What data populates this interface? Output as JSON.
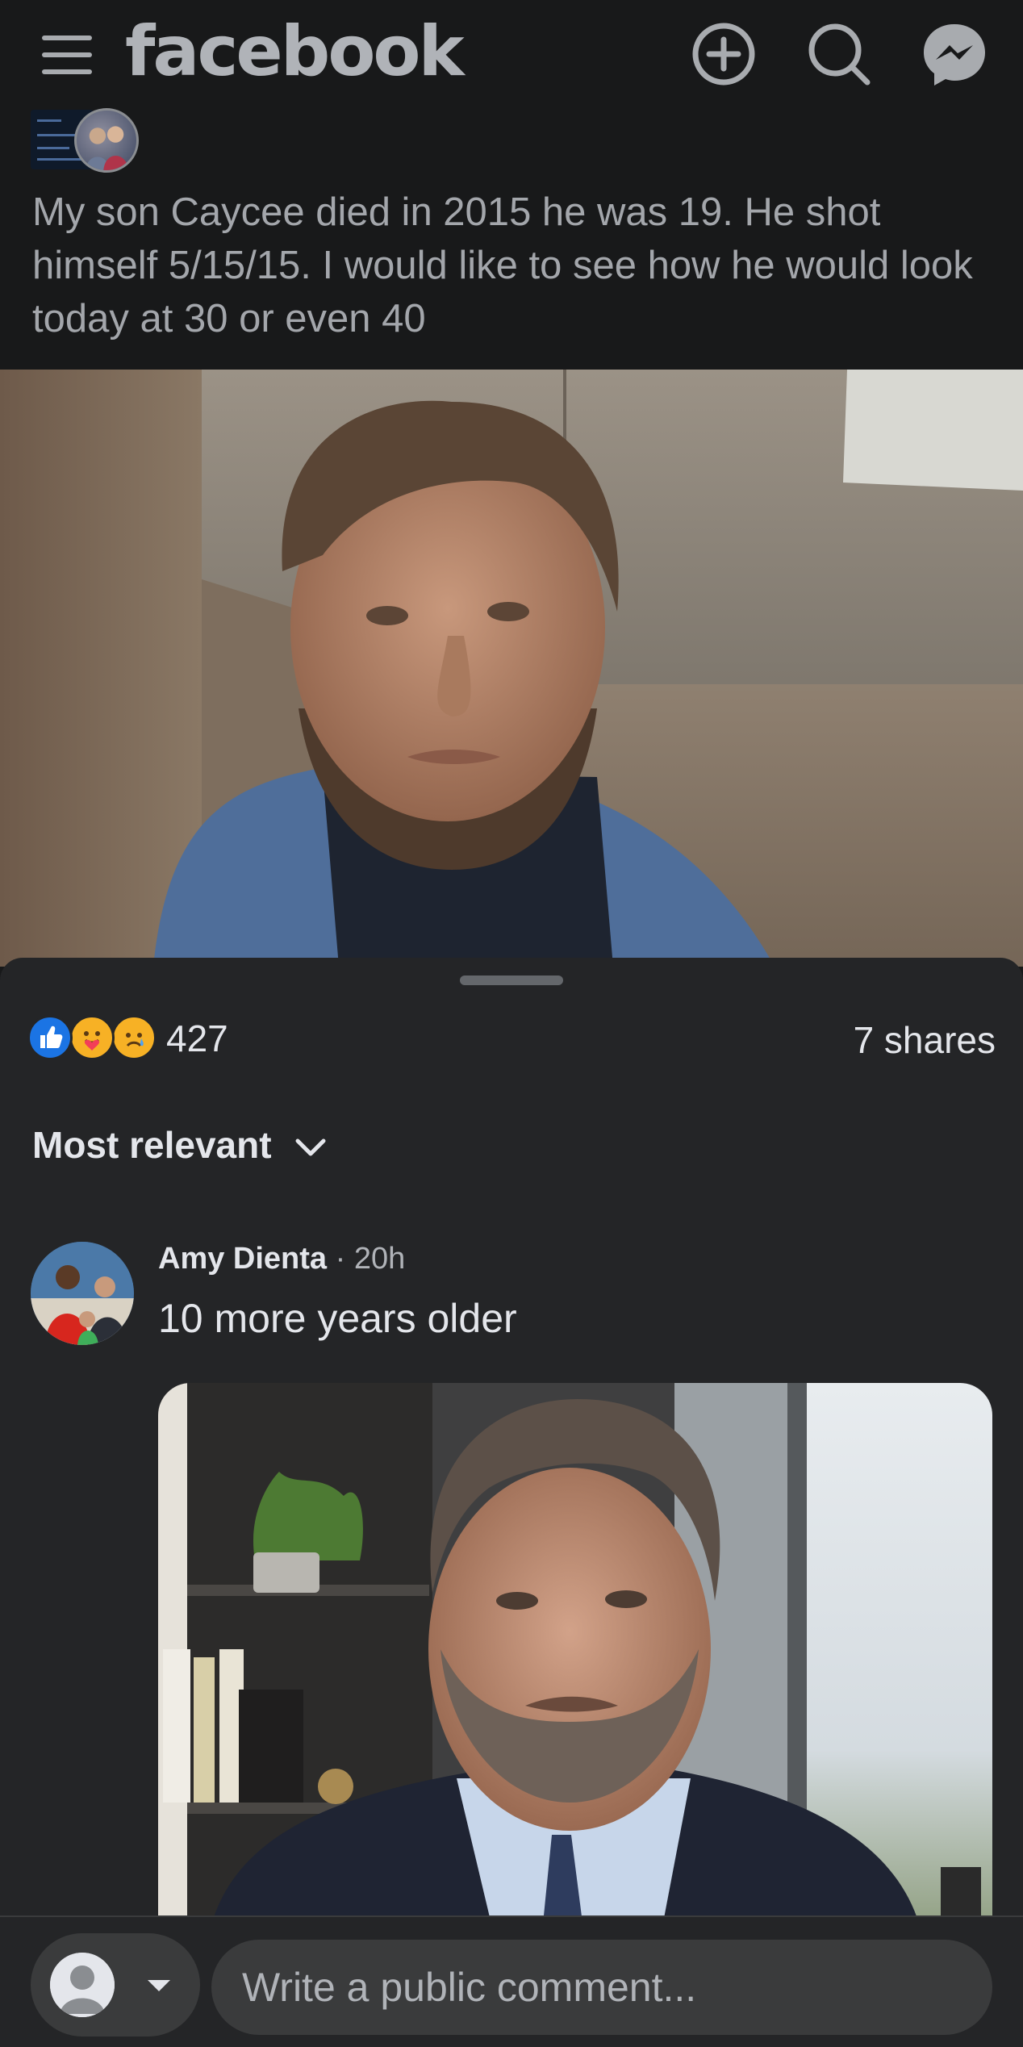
{
  "app": {
    "wordmark": "facebook"
  },
  "topbar": {
    "icons": [
      "menu-icon",
      "create-post-icon",
      "search-icon",
      "messenger-icon"
    ]
  },
  "post": {
    "text": "My son Caycee died in 2015 he was 19. He shot himself 5/15/15. I would like to see how he would look today at 30 or even 40"
  },
  "reactions": {
    "types": [
      "like",
      "care",
      "sad"
    ],
    "count": "427",
    "shares": "7 shares"
  },
  "comments": {
    "sort_label": "Most relevant",
    "items": [
      {
        "author": "Amy Dienta",
        "time": "· 20h",
        "text": "10 more years older"
      }
    ]
  },
  "composer": {
    "placeholder": "Write a public comment..."
  },
  "colors": {
    "background": "#18191a",
    "sheet": "#242527",
    "like_blue": "#1b74e4",
    "reaction_yellow": "#f7b125"
  }
}
